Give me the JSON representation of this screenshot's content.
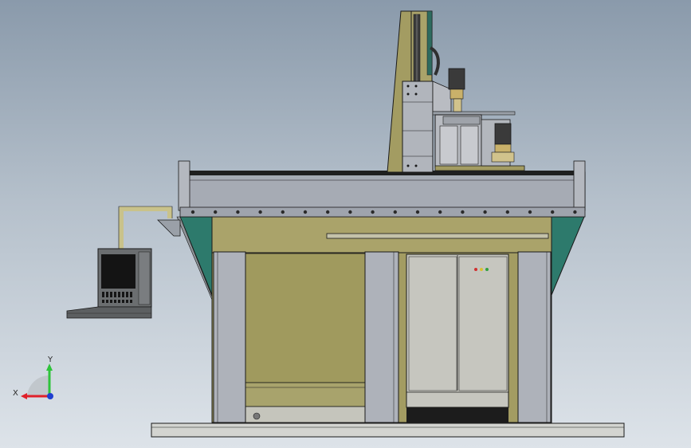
{
  "triad": {
    "x_label": "X",
    "y_label": "Y",
    "x_color": "#e0202a",
    "y_color": "#2ec43a",
    "z_color": "#1f3fd0"
  },
  "colors": {
    "background_top": "#8a9aab",
    "background_bottom": "#dde3e9",
    "khaki": "#a39c62",
    "steel": "#aeb2ba",
    "teal": "#2d7a6c",
    "cabinet": "#c8c8c1",
    "monitor": "#6b6e70",
    "outline": "#1a1a1a"
  }
}
